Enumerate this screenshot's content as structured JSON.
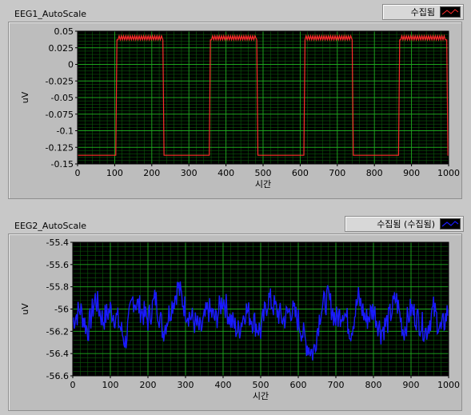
{
  "charts": [
    {
      "title": "EEG1_AutoScale",
      "legend": "수집됨",
      "line_color": "#ff2b2b",
      "xlabel": "시간",
      "ylabel": "uV",
      "xticks": [
        "0",
        "100",
        "200",
        "300",
        "400",
        "500",
        "600",
        "700",
        "800",
        "900",
        "1000"
      ],
      "yticks": [
        "0.05",
        "0.025",
        "0",
        "-0.025",
        "-0.05",
        "-0.075",
        "-0.1",
        "-0.125",
        "-0.15"
      ]
    },
    {
      "title": "EEG2_AutoScale",
      "legend": "수집됨 (수집됨)",
      "line_color": "#1a1aff",
      "xlabel": "시간",
      "ylabel": "uV",
      "xticks": [
        "0",
        "100",
        "200",
        "300",
        "400",
        "500",
        "600",
        "700",
        "800",
        "900",
        "1000"
      ],
      "yticks": [
        "-55.4",
        "-55.6",
        "-55.8",
        "-56",
        "-56.2",
        "-56.4",
        "-56.6"
      ]
    }
  ],
  "chart_data": [
    {
      "type": "line",
      "title": "EEG1_AutoScale",
      "xlabel": "시간",
      "ylabel": "uV",
      "xlim": [
        0,
        1000
      ],
      "ylim": [
        -0.15,
        0.05
      ],
      "grid": true,
      "legend_position": "top-right",
      "series": [
        {
          "name": "수집됨",
          "color": "#ff2b2b",
          "x": [
            0,
            103,
            106,
            230,
            233,
            355,
            358,
            483,
            486,
            610,
            613,
            740,
            743,
            865,
            868,
            995,
            998,
            1000
          ],
          "y": [
            -0.137,
            -0.137,
            0.037,
            0.037,
            -0.137,
            -0.137,
            0.037,
            0.037,
            -0.137,
            -0.137,
            0.037,
            0.037,
            -0.137,
            -0.137,
            0.037,
            0.037,
            -0.137,
            -0.137
          ]
        }
      ]
    },
    {
      "type": "line",
      "title": "EEG2_AutoScale",
      "xlabel": "시간",
      "ylabel": "uV",
      "xlim": [
        0,
        1000
      ],
      "ylim": [
        -56.6,
        -55.4
      ],
      "grid": true,
      "legend_position": "top-right",
      "series": [
        {
          "name": "수집됨 (수집됨)",
          "color": "#1a1aff",
          "x": [
            0,
            20,
            40,
            60,
            80,
            100,
            120,
            140,
            160,
            180,
            200,
            220,
            240,
            260,
            280,
            300,
            320,
            340,
            360,
            380,
            400,
            420,
            440,
            460,
            480,
            500,
            520,
            540,
            560,
            580,
            600,
            620,
            640,
            660,
            680,
            700,
            720,
            740,
            760,
            780,
            800,
            820,
            840,
            860,
            880,
            900,
            920,
            940,
            960,
            980,
            1000
          ],
          "y": [
            -56.1,
            -56.0,
            -56.2,
            -55.9,
            -56.1,
            -56.0,
            -56.1,
            -56.3,
            -55.9,
            -56.0,
            -56.1,
            -55.9,
            -56.2,
            -56.0,
            -55.8,
            -56.0,
            -56.1,
            -56.2,
            -56.0,
            -56.1,
            -55.9,
            -56.1,
            -56.2,
            -56.0,
            -56.1,
            -56.2,
            -55.9,
            -56.0,
            -56.1,
            -56.0,
            -56.1,
            -56.3,
            -56.4,
            -56.0,
            -55.9,
            -56.1,
            -56.0,
            -56.2,
            -55.9,
            -56.1,
            -56.0,
            -56.2,
            -56.1,
            -55.9,
            -56.2,
            -56.0,
            -56.1,
            -56.2,
            -56.0,
            -56.2,
            -56.0
          ]
        }
      ]
    }
  ]
}
